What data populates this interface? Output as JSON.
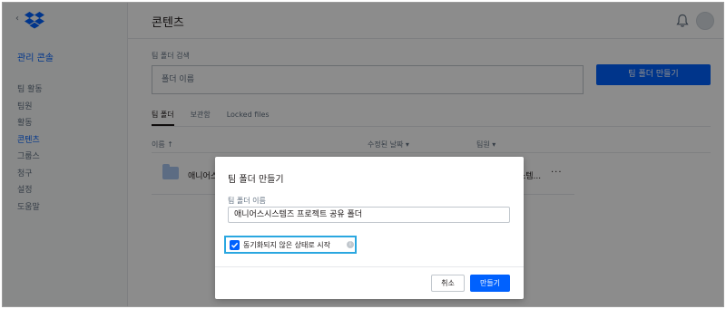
{
  "sidebar": {
    "admin_title": "관리 콘솔",
    "items": [
      {
        "label": "팀 활동",
        "active": false
      },
      {
        "label": "팀원",
        "active": false
      },
      {
        "label": "활동",
        "active": false
      },
      {
        "label": "콘텐츠",
        "active": true
      },
      {
        "label": "그룹스",
        "active": false
      },
      {
        "label": "청구",
        "active": false
      },
      {
        "label": "설정",
        "active": false
      },
      {
        "label": "도움말",
        "active": false
      }
    ]
  },
  "header": {
    "title": "콘텐츠"
  },
  "search": {
    "label": "팀 폴더 검색",
    "placeholder": "폴더 이름"
  },
  "create_button": "팀 폴더 만들기",
  "tabs": [
    {
      "label": "팀 폴더",
      "active": true
    },
    {
      "label": "보관함",
      "active": false
    },
    {
      "label": "Locked files",
      "active": false
    }
  ],
  "table": {
    "headers": {
      "name": "이름 ↑",
      "modified": "수정된 날짜 ▾",
      "members": "팀원 ▾"
    },
    "rows": [
      {
        "name": "애니어스",
        "members": "스템...",
        "more": "···"
      }
    ]
  },
  "modal": {
    "title": "팀 폴더 만들기",
    "name_label": "팀 폴더 이름",
    "name_value": "애니어스시스템즈 프로젝트 공유 폴더",
    "sync_label": "동기화되지 않은 상태로 시작",
    "sync_checked": true,
    "cancel_label": "취소",
    "confirm_label": "만들기"
  },
  "colors": {
    "accent": "#0061fe",
    "highlight_border": "#2aa7e0"
  }
}
